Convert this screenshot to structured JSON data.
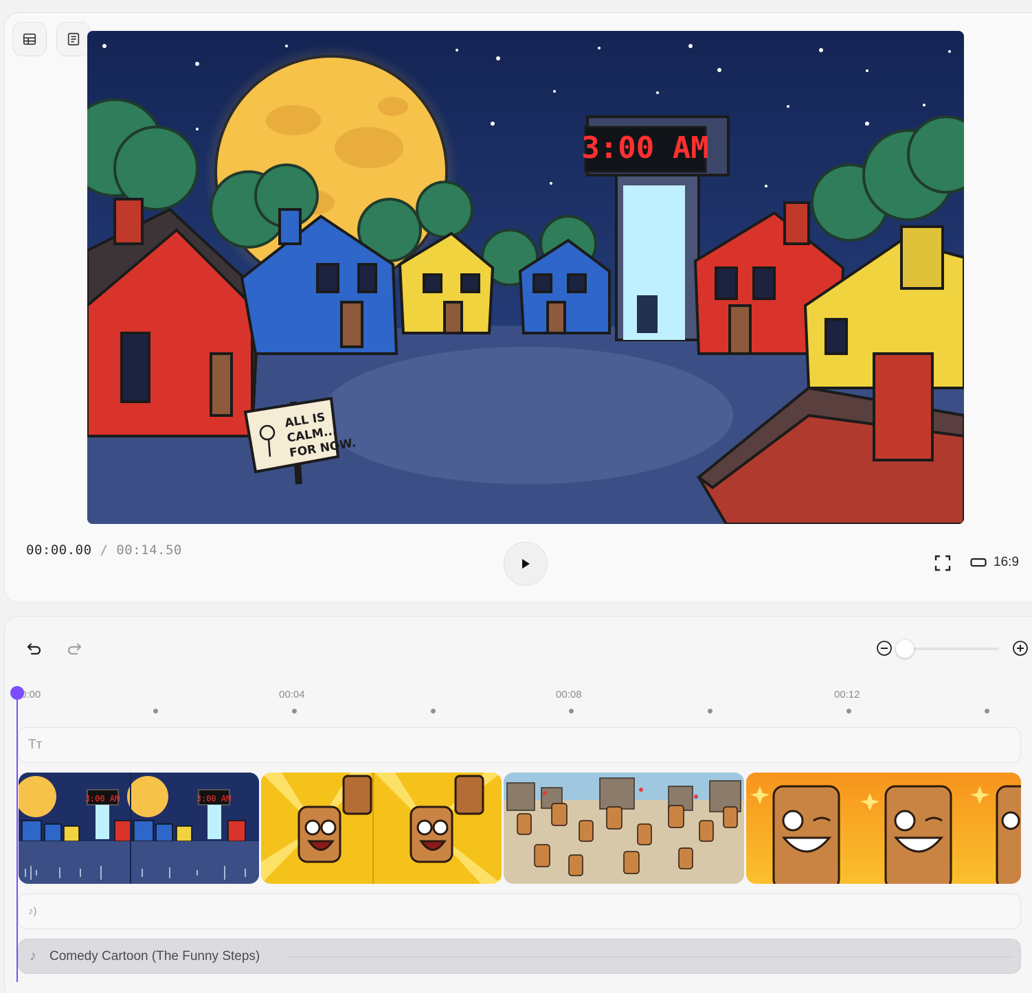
{
  "toolbar": {
    "grid_view_icon": "table-layout-icon",
    "script_view_icon": "document-lines-icon"
  },
  "preview": {
    "scene_clock_text": "3:00 AM",
    "sign_text_line1": "ALL IS",
    "sign_text_line2": "CALM...",
    "sign_text_line3": "FOR NOW."
  },
  "playback": {
    "current_time": "00:00.00",
    "separator": " / ",
    "total_time": "00:14.50",
    "aspect_ratio": "16:9"
  },
  "timeline": {
    "zoom_level": 0.05,
    "ruler": {
      "labels": [
        "0:00",
        "00:04",
        "00:08",
        "00:12"
      ]
    },
    "text_track_icon": "Tт",
    "voice_track_icon": "♪)",
    "clips": [
      {
        "name": "night-village-clip",
        "caption_1": "3:00 AM",
        "caption_2": "3:00 AM"
      },
      {
        "name": "log-hammer-clip"
      },
      {
        "name": "log-crowd-clip"
      },
      {
        "name": "log-celebration-clip"
      }
    ],
    "music_icon": "♪",
    "music_title": "Comedy Cartoon (The Funny Steps)"
  },
  "colors": {
    "accent": "#7c4dff",
    "sky": "#1f2f66",
    "moon": "#f6c24a"
  }
}
